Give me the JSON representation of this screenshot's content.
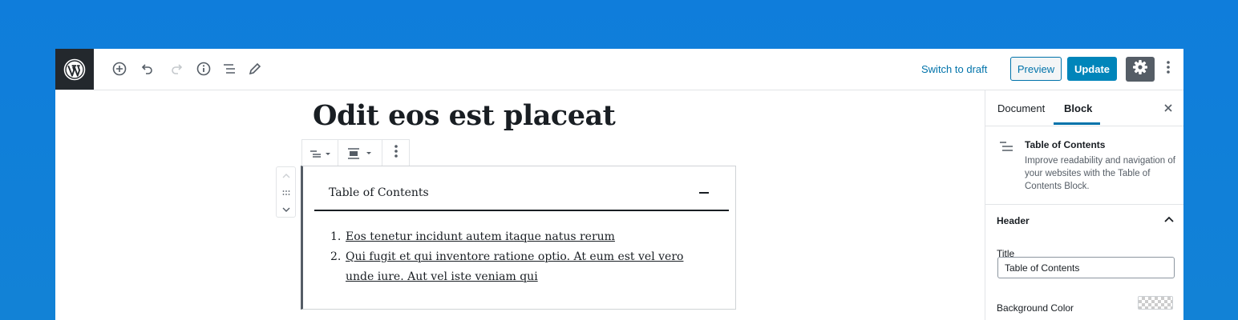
{
  "topbar": {
    "logo": "wordpress-logo",
    "tools": [
      "add-block-icon",
      "undo-icon",
      "redo-icon",
      "info-icon",
      "block-navigation-icon",
      "edit-tools-icon"
    ],
    "switch_to_draft": "Switch to draft",
    "preview_label": "Preview",
    "update_label": "Update"
  },
  "editor": {
    "post_title": "Odit eos est placeat",
    "toc": {
      "heading": "Table of Contents",
      "items": [
        {
          "number": "1.",
          "text": "Eos tenetur incidunt autem itaque natus rerum"
        },
        {
          "number": "2.",
          "text": "Qui fugit et qui inventore ratione optio. At eum est vel vero unde iure. Aut vel iste veniam qui"
        }
      ]
    }
  },
  "sidebar": {
    "tabs": [
      {
        "label": "Document",
        "active": false
      },
      {
        "label": "Block",
        "active": true
      }
    ],
    "block_card": {
      "title": "Table of Contents",
      "description": "Improve readability and navigation of your websites with the Table of Contents Block."
    },
    "header_panel": {
      "title": "Header",
      "field_title_label": "Title",
      "field_title_value": "Table of Contents",
      "background_color_label": "Background Color"
    }
  },
  "colors": {
    "background": "#0f7ddb",
    "accent": "#0073aa",
    "update_button": "#0085ba",
    "logo_bg": "#23282d"
  }
}
